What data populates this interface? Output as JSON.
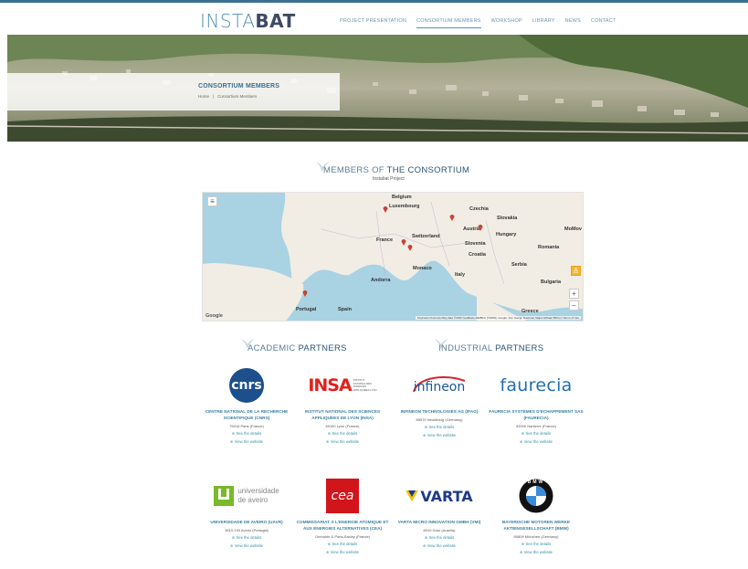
{
  "header": {
    "logo_light": "INSTA",
    "logo_bold": "BAT",
    "nav": [
      {
        "label": "PROJECT PRESENTATION",
        "active": false
      },
      {
        "label": "CONSORTIUM MEMBERS",
        "active": true
      },
      {
        "label": "WORKSHOP",
        "active": false
      },
      {
        "label": "LIBRARY",
        "active": false
      },
      {
        "label": "NEWS",
        "active": false
      },
      {
        "label": "CONTACT",
        "active": false
      }
    ]
  },
  "hero": {
    "title": "CONSORTIUM MEMBERS",
    "breadcrumb_home": "Home",
    "breadcrumb_sep": "|",
    "breadcrumb_current": "Consortium Members"
  },
  "members": {
    "title_light": "MEMBERS OF",
    "title_bold": "THE CONSORTIUM",
    "subtitle": "Instabat Project"
  },
  "map": {
    "labels": {
      "belgium": "Belgium",
      "luxembourg": "Luxembourg",
      "czechia": "Czechia",
      "slovakia": "Slovakia",
      "moldova": "MoMov",
      "austria": "Austria",
      "hungary": "Hungary",
      "france": "France",
      "switzerland": "Switzerland",
      "slovenia": "Slovenia",
      "romania": "Romania",
      "croatia": "Croatia",
      "serbia": "Serbia",
      "monaco": "Monaco",
      "bulgaria": "Bulgaria",
      "andorra": "Andorra",
      "italy": "Italy",
      "portugal": "Portugal",
      "spain": "Spain",
      "greece": "Greece",
      "google": "Google"
    },
    "footer": "Keyboard shortcuts   Map data ©2020 GeoBasis-DE/BKG (©2009), Google, Inst. Geogr. Nacional, Mapa GISrael   500 km   Terms of Use"
  },
  "academic": {
    "title_light": "ACADEMIC",
    "title_bold": "PARTNERS"
  },
  "industrial": {
    "title_light": "INDUSTRIAL",
    "title_bold": "PARTNERS"
  },
  "links": {
    "details": "⊕ See the details",
    "website": "⊕ View the website"
  },
  "partners": [
    {
      "logo_text": "cnrs",
      "name": "CENTRE NATIONAL DE LA RECHERCHE SCIENTIFIQUE (CNRS)",
      "address": "75016 Paris (France)"
    },
    {
      "logo_text": "INSA",
      "logo_sub": "INSTITUT NATIONAL DES SCIENCES APPLIQUÉES LYON",
      "name": "INSTITUT NATIONAL DES SCIENCES APPLIQUÉES DE LYON (INSA)",
      "address": "69100 Lyon (France)"
    },
    {
      "logo_text": "infineon",
      "name": "INFINEON TECHNOLOGIES AG (IFAG)",
      "address": "85579 Neubiberg (Germany)"
    },
    {
      "logo_text": "faurecia",
      "name": "FAURECIA SYSTEMES D'ECHAPPEMENT SAS (FAURECIA)",
      "address": "92000 Nanterre (France)"
    },
    {
      "logo_text": "universidade",
      "logo_sub": "de aveiro",
      "name": "UNIVERSIDADE DE AVEIRO (UAVR)",
      "address": "3810-193 Aveiro (Portugal)"
    },
    {
      "logo_text": "cea",
      "name": "COMMISSARIAT À L'ENERGIE ATOMIQUE ET AUX ENERGIES ALTERNATIVES (CEA)",
      "address": "Grenoble & Paris-Saclay (France)"
    },
    {
      "logo_text": "VARTA",
      "name": "VARTA MICRO INNOVATION GMBH (VMI)",
      "address": "8010 Graz (Austria)"
    },
    {
      "logo_text": "BMW",
      "name": "BAYERISCHE MOTOREN WERKE AKTIENGESELLSCHAFT (BMW)",
      "address": "80809 München (Germany)"
    }
  ]
}
